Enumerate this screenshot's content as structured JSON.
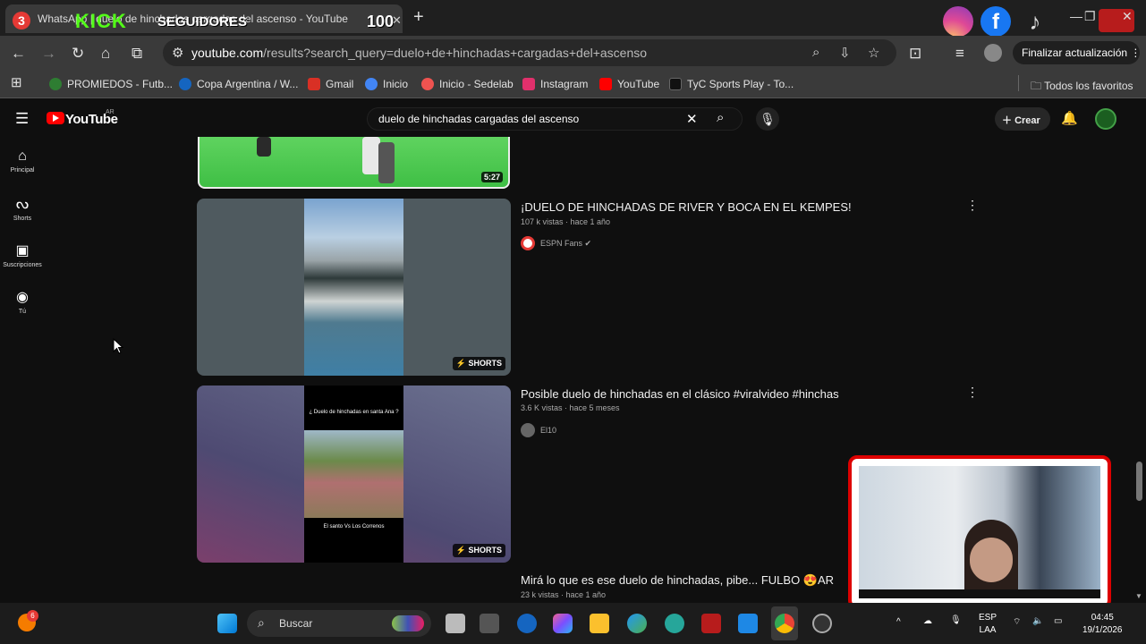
{
  "browser": {
    "tab_badge": "3",
    "tab_title": "WhatsApp | duelo de hinchadas cargadas del ascenso - YouTube",
    "overlay_kick": "KICK",
    "overlay_followers": "SEGUIDORES",
    "overlay_count": "100",
    "url_host": "youtube.com",
    "url_path": "/results?search_query=duelo+de+hinchadas+cargadas+del+ascenso",
    "update_label": "Finalizar actualización"
  },
  "bookmarks": [
    {
      "label": "PROMIEDOS - Futb...",
      "color": "#2e7d32"
    },
    {
      "label": "Copa Argentina / W...",
      "color": "#1565c0"
    },
    {
      "label": "Gmail",
      "color": "#d93025"
    },
    {
      "label": "Inicio",
      "color": "#4285f4"
    },
    {
      "label": "Inicio - Sedelab",
      "color": "#ef5350"
    },
    {
      "label": "Instagram",
      "color": "#e1306c"
    },
    {
      "label": "YouTube",
      "color": "#ff0000"
    },
    {
      "label": "TyC Sports Play - To...",
      "color": "#333333"
    }
  ],
  "bookmarks_all": "Todos los favoritos",
  "youtube": {
    "logo": "YouTube",
    "region": "AR",
    "search_value": "duelo de hinchadas cargadas del ascenso",
    "create_label": "Crear",
    "rail": [
      {
        "label": "Principal",
        "icon": "home-icon"
      },
      {
        "label": "Shorts",
        "icon": "shorts-icon"
      },
      {
        "label": "Suscripciones",
        "icon": "subscriptions-icon"
      },
      {
        "label": "Tú",
        "icon": "you-icon"
      }
    ]
  },
  "results": [
    {
      "duration": "5:27"
    },
    {
      "title": "¡DUELO DE HINCHADAS DE RIVER Y BOCA EN EL KEMPES!",
      "meta": "107 k vistas · hace 1 año",
      "channel": "ESPN Fans",
      "badge": "SHORTS"
    },
    {
      "title": "Posible duelo de hinchadas en el clásico #viralvideo #hinchas",
      "meta": "3.6 K vistas · hace 5 meses",
      "channel": "El10",
      "badge": "SHORTS",
      "thumb_caption_top": "¿ Duelo de hinchadas en santa Ana ?",
      "thumb_caption_bottom": "El santo Vs Los Correnos"
    },
    {
      "title": "Mirá lo que es ese duelo de hinchadas, pibe... FULBO 😍AR",
      "meta": "23 k vistas · hace 1 año"
    }
  ],
  "taskbar": {
    "notification_count": "6",
    "search_placeholder": "Buscar",
    "lang_top": "ESP",
    "lang_bottom": "LAA",
    "time": "04:45",
    "date": "19/1/2026"
  }
}
